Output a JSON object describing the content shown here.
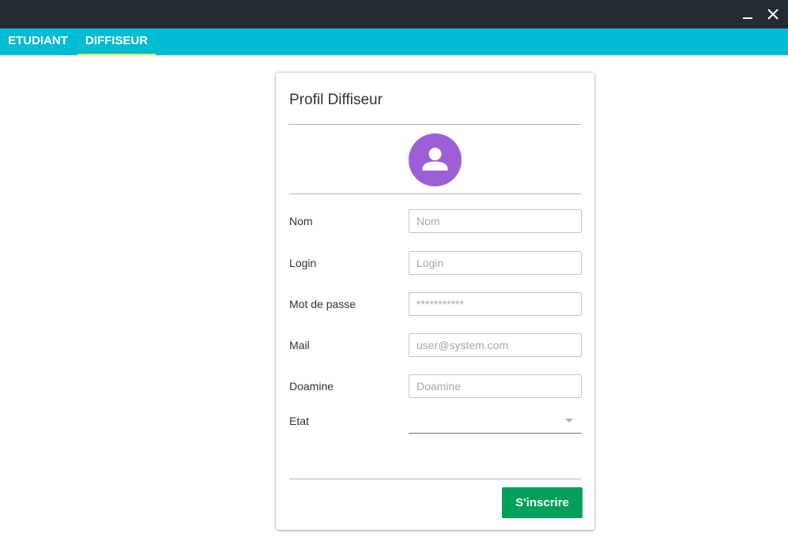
{
  "window": {
    "minimize_icon": "minimize-icon",
    "close_icon": "close-icon",
    "titlebar_color": "#242b33"
  },
  "tabs": [
    {
      "label": "ETUDIANT",
      "selected": false
    },
    {
      "label": "DIFFISEUR",
      "selected": true
    }
  ],
  "colors": {
    "tabbar": "#00bcd4",
    "tab_indicator": "#ffeb3b",
    "avatar": "#9c5fd5",
    "submit": "#00a05a"
  },
  "card": {
    "title": "Profil Diffiseur",
    "avatar_icon": "user-icon",
    "fields": [
      {
        "label": "Nom",
        "placeholder": "Nom",
        "value": ""
      },
      {
        "label": "Login",
        "placeholder": "Login",
        "value": ""
      },
      {
        "label": "Mot de passe",
        "placeholder": "***********",
        "value": ""
      },
      {
        "label": "Mail",
        "placeholder": "user@system.com",
        "value": ""
      },
      {
        "label": "Doamine",
        "placeholder": "Doamine",
        "value": ""
      }
    ],
    "etat": {
      "label": "Etat",
      "value": ""
    },
    "submit_label": "S'inscrire"
  }
}
